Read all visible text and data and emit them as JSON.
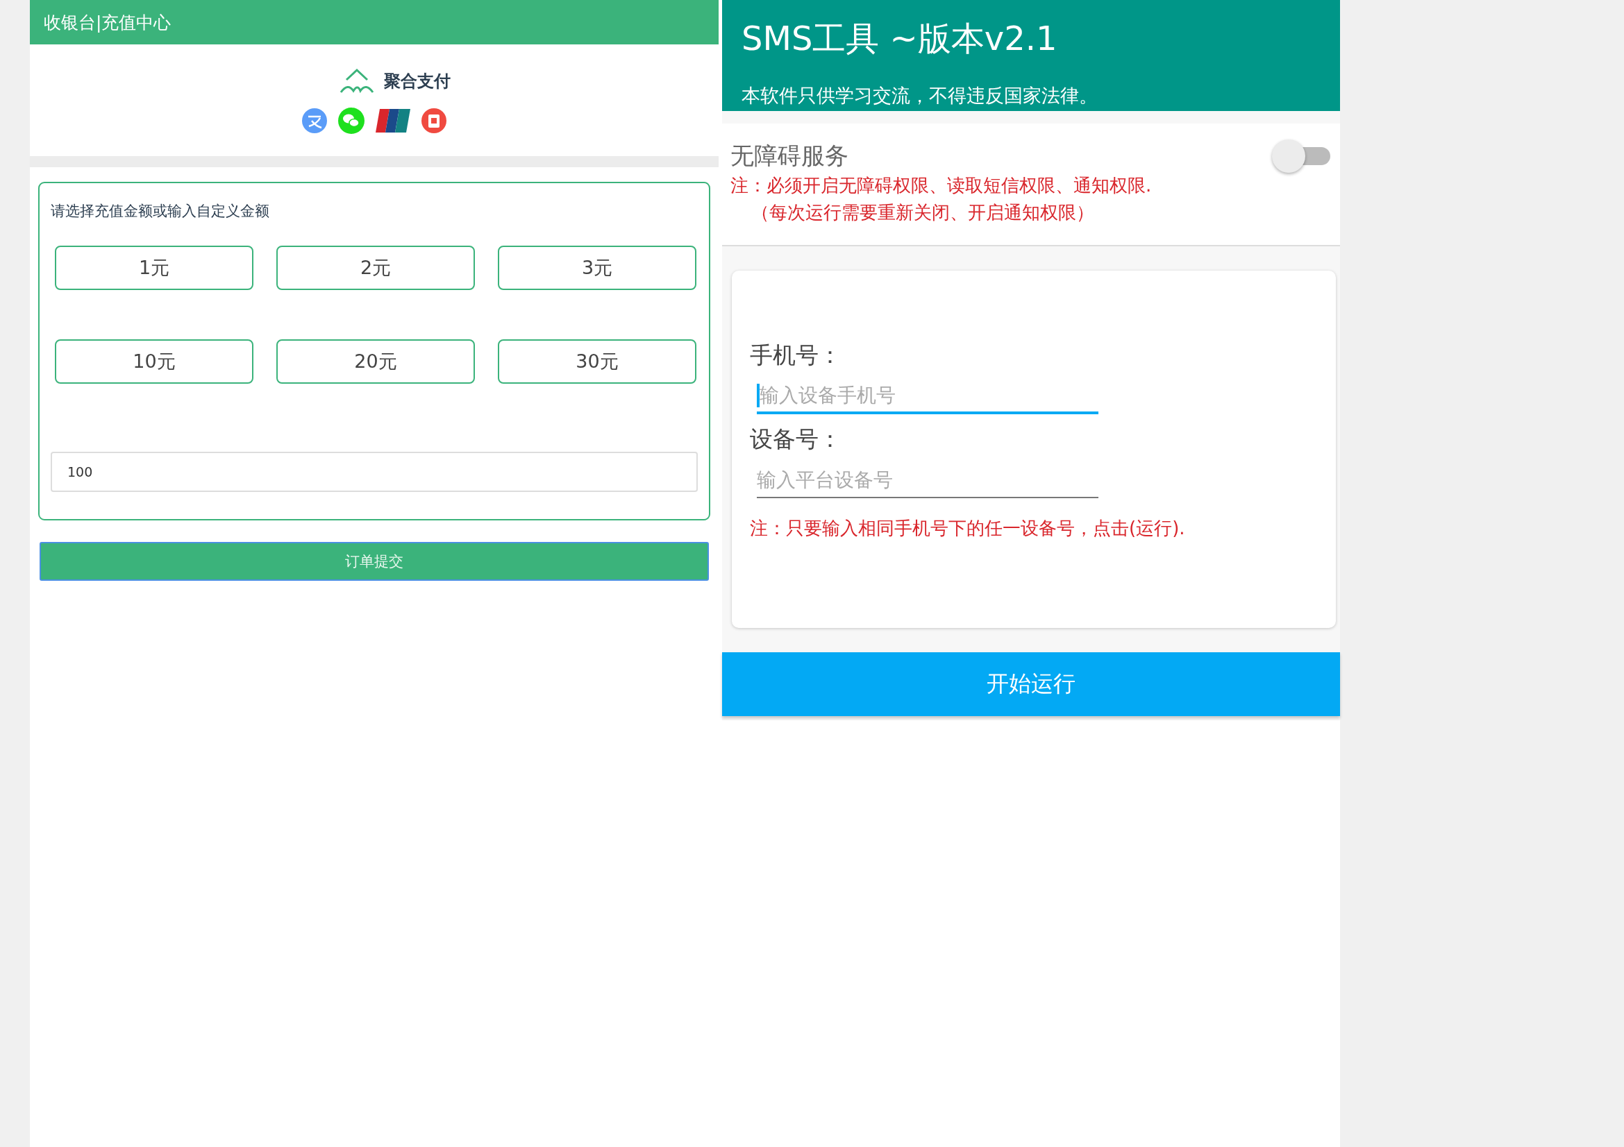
{
  "cashier": {
    "header_title": "收银台|充值中心",
    "brand": "聚合支付",
    "prompt": "请选择充值金额或输入自定义金额",
    "amounts": [
      "1元",
      "2元",
      "3元",
      "10元",
      "20元",
      "30元"
    ],
    "custom_amount": {
      "value": "100"
    },
    "submit_button": "订单提交"
  },
  "sms_tool": {
    "title": "SMS工具 ~版本v2.1",
    "subtitle": "本软件只供学习交流，不得违反国家法律。",
    "accessibility": {
      "label": "无障碍服务",
      "on": false,
      "notes": [
        "注：必须开启无障碍权限、读取短信权限、通知权限.",
        "（每次运行需要重新关闭、开启通知权限）"
      ]
    },
    "fields": [
      {
        "label": "手机号：",
        "placeholder": "输入设备手机号",
        "focused": true
      },
      {
        "label": "设备号：",
        "placeholder": "输入平台设备号",
        "focused": false
      }
    ],
    "note": "注：只要输入相同手机号下的任一设备号，点击(运行).",
    "run_button": "开始运行"
  }
}
